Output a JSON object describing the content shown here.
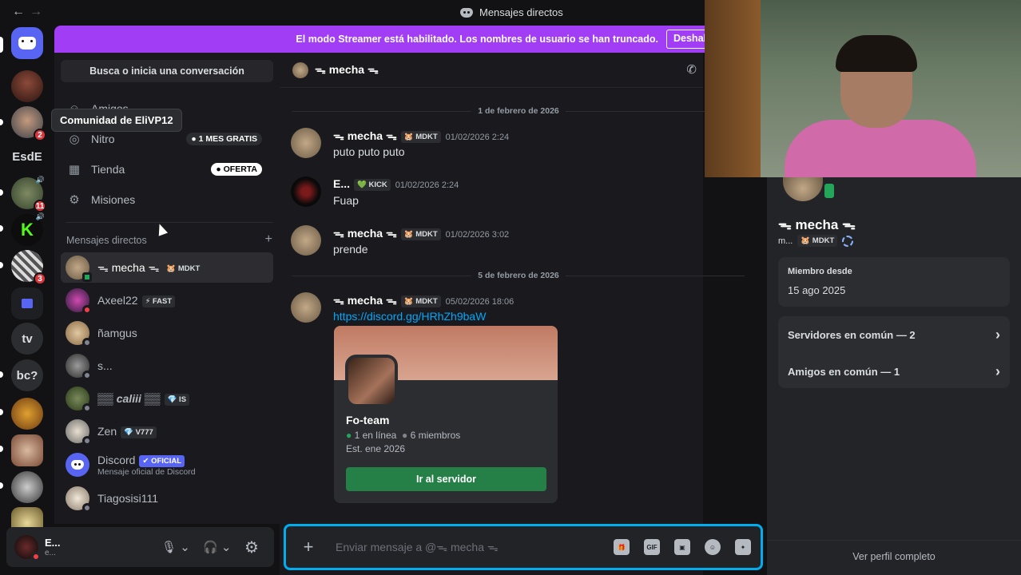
{
  "titlebar": {
    "title": "Mensajes directos",
    "back": "←",
    "forward": "→"
  },
  "banner": {
    "text": "El modo Streamer está habilitado. Los nombres de usuario se han truncado.",
    "button": "Deshabilitar"
  },
  "servers": [
    {
      "label": "",
      "badge": "",
      "kind": "home"
    },
    {
      "label": "",
      "badge": ""
    },
    {
      "label": "",
      "badge": "2"
    },
    {
      "label": "EsdE",
      "badge": ""
    },
    {
      "label": "",
      "badge": "11",
      "vol": "🔊"
    },
    {
      "label": "",
      "badge": "",
      "vol": "🔊"
    },
    {
      "label": "",
      "badge": "3"
    },
    {
      "label": "",
      "badge": "",
      "kind": "folder"
    },
    {
      "label": "tv",
      "badge": ""
    },
    {
      "label": "bc?",
      "badge": ""
    }
  ],
  "tooltip": "Comunidad de EliVP12",
  "sidebar": {
    "search": "Busca o inicia una conversación",
    "nav": [
      {
        "label": "Amigos",
        "icon": "☺",
        "badge": ""
      },
      {
        "label": "Nitro",
        "icon": "◎",
        "badge": "1 MES GRATIS"
      },
      {
        "label": "Tienda",
        "icon": "▦",
        "badge": "OFERTA"
      },
      {
        "label": "Misiones",
        "icon": "⚙",
        "badge": ""
      }
    ],
    "dm_header": "Mensajes directos",
    "dm_add": "+",
    "dms": [
      {
        "name": "ᯓ mecha ᯓ",
        "tag": "🐹 MDKT",
        "sub": ""
      },
      {
        "name": "Axeel22",
        "tag": "⚡ FAST",
        "sub": ""
      },
      {
        "name": "ñamgus",
        "tag": "",
        "sub": ""
      },
      {
        "name": "s...",
        "tag": "",
        "sub": ""
      },
      {
        "name": "▒▒ caliii ▒▒",
        "tag": "💎 IS",
        "sub": ""
      },
      {
        "name": "Zen",
        "tag": "💎 V777",
        "sub": ""
      },
      {
        "name": "Discord",
        "tag": "✔ OFICIAL",
        "sub": "Mensaje oficial de Discord"
      },
      {
        "name": "Tiagosisi111",
        "tag": "",
        "sub": ""
      }
    ]
  },
  "userbar": {
    "name": "E...",
    "sub": "e..."
  },
  "chat": {
    "header_name": "ᯓ mecha ᯓ",
    "date1": "1 de febrero de 2026",
    "date2": "5 de febrero de 2026",
    "messages": [
      {
        "author": "ᯓ mecha ᯓ",
        "tag": "🐹 MDKT",
        "time": "01/02/2026 2:24",
        "text": "puto puto puto"
      },
      {
        "author": "E...",
        "tag": "💚 KICK",
        "time": "01/02/2026 2:24",
        "text": "Fuap"
      },
      {
        "author": "ᯓ mecha ᯓ",
        "tag": "🐹 MDKT",
        "time": "01/02/2026 3:02",
        "text": "prende"
      },
      {
        "author": "ᯓ mecha ᯓ",
        "tag": "🐹 MDKT",
        "time": "05/02/2026 18:06",
        "text": "https://discord.gg/HRhZh9baW"
      }
    ],
    "invite": {
      "name": "Fo-team",
      "online": "1 en línea",
      "members": "6 miembros",
      "est": "Est. ene 2026",
      "button": "Ir al servidor"
    },
    "composer_placeholder": "Enviar mensaje a @ᯓ mecha ᯓ",
    "composer_tools": [
      "🎁",
      "GIF",
      "▣",
      "☺",
      "✦"
    ]
  },
  "profile": {
    "name": "ᯓ mecha ᯓ",
    "handle": "m...",
    "tag": "🐹 MDKT",
    "member_label": "Miembro desde",
    "member_date": "15 ago 2025",
    "mutual_servers": "Servidores en común — 2",
    "mutual_friends": "Amigos en común — 1",
    "view_full": "Ver perfil completo"
  },
  "colors": {
    "accent": "#5865f2",
    "banner": "#a23df6",
    "green": "#248046",
    "link": "#00a8fc",
    "composer_border": "#00aeef"
  }
}
